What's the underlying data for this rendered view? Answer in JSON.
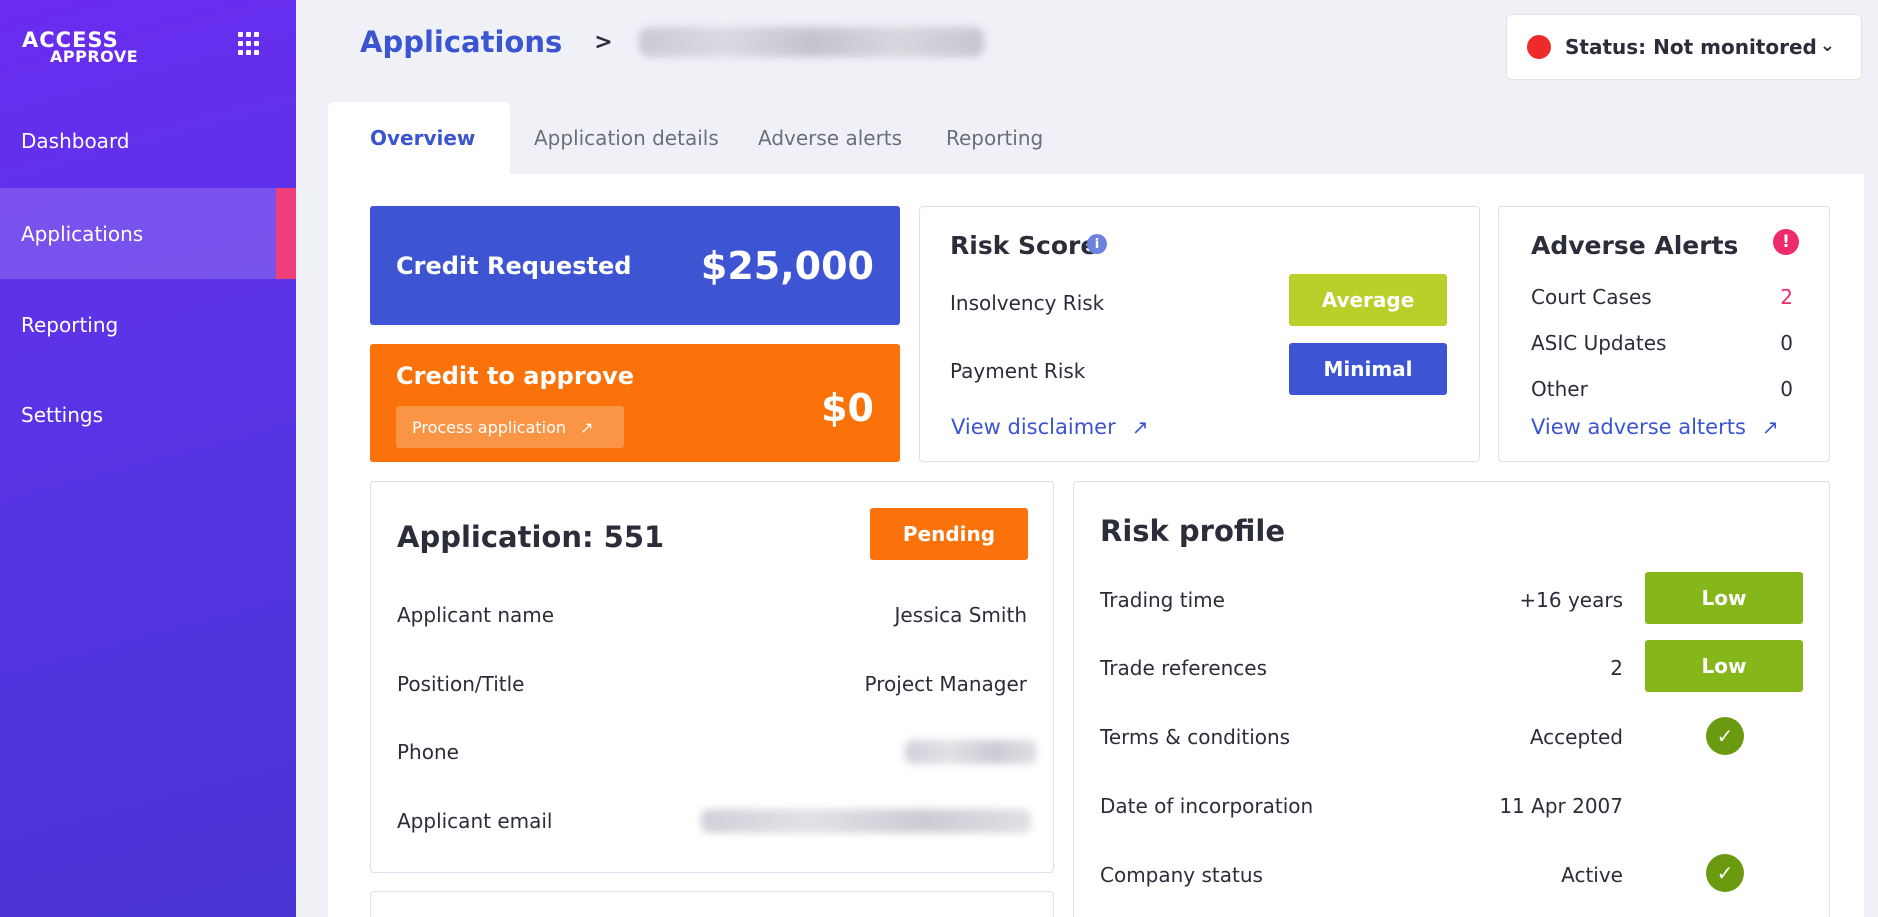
{
  "logo": {
    "line1": "ACCESS",
    "line2": "APPROVE"
  },
  "sidebar": {
    "items": [
      {
        "label": "Dashboard"
      },
      {
        "label": "Applications"
      },
      {
        "label": "Reporting"
      },
      {
        "label": "Settings"
      }
    ]
  },
  "header": {
    "breadcrumb_root": "Applications",
    "breadcrumb_separator": ">",
    "status_label": "Status: Not monitored"
  },
  "tabs": [
    {
      "label": "Overview"
    },
    {
      "label": "Application details"
    },
    {
      "label": "Adverse alerts"
    },
    {
      "label": "Reporting"
    }
  ],
  "credit_requested": {
    "label": "Credit Requested",
    "value": "$25,000"
  },
  "credit_to_approve": {
    "label": "Credit to approve",
    "value": "$0",
    "action_label": "Process application"
  },
  "risk_score": {
    "title": "Risk Score",
    "rows": [
      {
        "label": "Insolvency Risk",
        "badge": "Average"
      },
      {
        "label": "Payment Risk",
        "badge": "Minimal"
      }
    ],
    "link_label": "View disclaimer"
  },
  "adverse_alerts": {
    "title": "Adverse Alerts",
    "rows": [
      {
        "label": "Court Cases",
        "value": "2"
      },
      {
        "label": "ASIC Updates",
        "value": "0"
      },
      {
        "label": "Other",
        "value": "0"
      }
    ],
    "link_label": "View adverse alterts"
  },
  "application": {
    "title": "Application: 551",
    "status_badge": "Pending",
    "rows": [
      {
        "label": "Applicant name",
        "value": "Jessica Smith"
      },
      {
        "label": "Position/Title",
        "value": "Project Manager"
      },
      {
        "label": "Phone",
        "value": ""
      },
      {
        "label": "Applicant email",
        "value": ""
      }
    ]
  },
  "risk_profile": {
    "title": "Risk profile",
    "rows": [
      {
        "label": "Trading time",
        "value": "+16 years",
        "badge": "Low"
      },
      {
        "label": "Trade references",
        "value": "2",
        "badge": "Low"
      },
      {
        "label": "Terms & conditions",
        "value": "Accepted",
        "indicator": "check-icon"
      },
      {
        "label": "Date of incorporation",
        "value": "11 Apr 2007"
      },
      {
        "label": "Company status",
        "value": "Active",
        "indicator": "check-icon"
      }
    ]
  },
  "colors": {
    "brand_blue": "#3d55d2",
    "brand_orange": "#fa7209",
    "sidebar_accent": "#ee3f7a",
    "status_red": "#ee2b2b",
    "low_green": "#85b61a",
    "average_lime": "#b9cf2a"
  }
}
